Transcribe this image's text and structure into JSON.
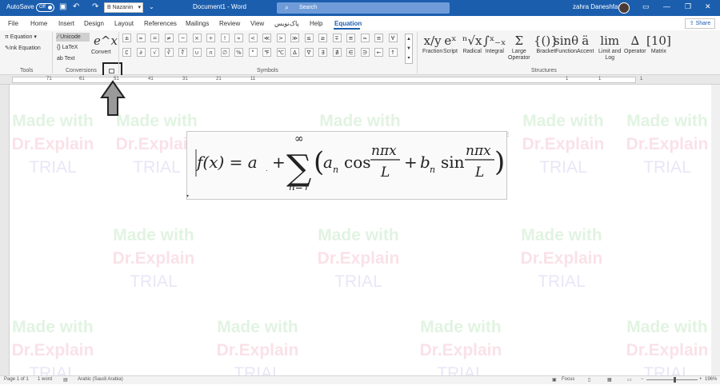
{
  "titlebar": {
    "autosave_label": "AutoSave",
    "autosave_state": "Off",
    "font_name": "B Nazanin",
    "doc_title": "Document1 - Word",
    "search_placeholder": "Search",
    "user_name": "zahra Daneshfar"
  },
  "tabs": [
    "File",
    "Home",
    "Insert",
    "Design",
    "Layout",
    "References",
    "Mailings",
    "Review",
    "View",
    "پاک‌نویس",
    "Help",
    "Equation"
  ],
  "active_tab": "Equation",
  "share_label": "Share",
  "ribbon": {
    "tools": {
      "group_label": "Tools",
      "equation_label": "Equation",
      "ink_equation_label": "Ink Equation"
    },
    "conversions": {
      "group_label": "Conversions",
      "unicode_label": "Unicode",
      "latex_label": "LaTeX",
      "text_label": "Text",
      "convert_label": "Convert",
      "convert_icon": "e^x"
    },
    "symbols": {
      "group_label": "Symbols",
      "row1": [
        "±",
        "∞",
        "=",
        "≠",
        "~",
        "×",
        "÷",
        "!",
        "∝",
        "<",
        "≪",
        ">",
        "≫",
        "≤",
        "≥",
        "∓",
        "≅",
        "≈",
        "≡",
        "∀"
      ],
      "row2": [
        "∁",
        "∂",
        "√",
        "∛",
        "∜",
        "∪",
        "∩",
        "∅",
        "%",
        "°",
        "℉",
        "℃",
        "∆",
        "∇",
        "∃",
        "∄",
        "∈",
        "∋",
        "←",
        "↑"
      ]
    },
    "structures": {
      "group_label": "Structures",
      "items": [
        {
          "label": "Fraction",
          "sub": "",
          "glyph": "x/y"
        },
        {
          "label": "Script",
          "sub": "",
          "glyph": "eˣ"
        },
        {
          "label": "Radical",
          "sub": "",
          "glyph": "ⁿ√x"
        },
        {
          "label": "Integral",
          "sub": "",
          "glyph": "∫ˣ₋ₓ"
        },
        {
          "label": "Large",
          "sub": "Operator",
          "glyph": "Σ"
        },
        {
          "label": "Bracket",
          "sub": "",
          "glyph": "{()}"
        },
        {
          "label": "Function",
          "sub": "",
          "glyph": "sinθ"
        },
        {
          "label": "Accent",
          "sub": "",
          "glyph": "ä"
        },
        {
          "label": "Limit and",
          "sub": "Log",
          "glyph": "lim"
        },
        {
          "label": "Operator",
          "sub": "",
          "glyph": "∆"
        },
        {
          "label": "Matrix",
          "sub": "",
          "glyph": "[10]"
        }
      ]
    }
  },
  "ruler_numbers": [
    "71",
    "61",
    "51",
    "41",
    "31",
    "21",
    "11",
    "1",
    "1",
    "1"
  ],
  "equation": {
    "lhs": "f(x) = a",
    "a0_sub": ".",
    "plus": "+",
    "sum_upper": "∞",
    "sum_lower": "n=١",
    "an": "a",
    "an_sub": "n",
    "cos": "cos",
    "frac_num": "nπx",
    "frac_den": "L",
    "bn": "b",
    "bn_sub": "n",
    "sin": "sin"
  },
  "watermark": {
    "line1": "Made with",
    "line2": "Dr.Explain",
    "line3": "TRIAL"
  },
  "status": {
    "page": "Page 1 of 1",
    "words": "1 word",
    "language": "Arabic (Saudi Arabia)",
    "focus": "Focus",
    "zoom": "196%"
  },
  "colors": {
    "titlebar": "#1b5eae",
    "ribbon_bg": "#f5f5f5",
    "accent": "#1b5eae"
  }
}
